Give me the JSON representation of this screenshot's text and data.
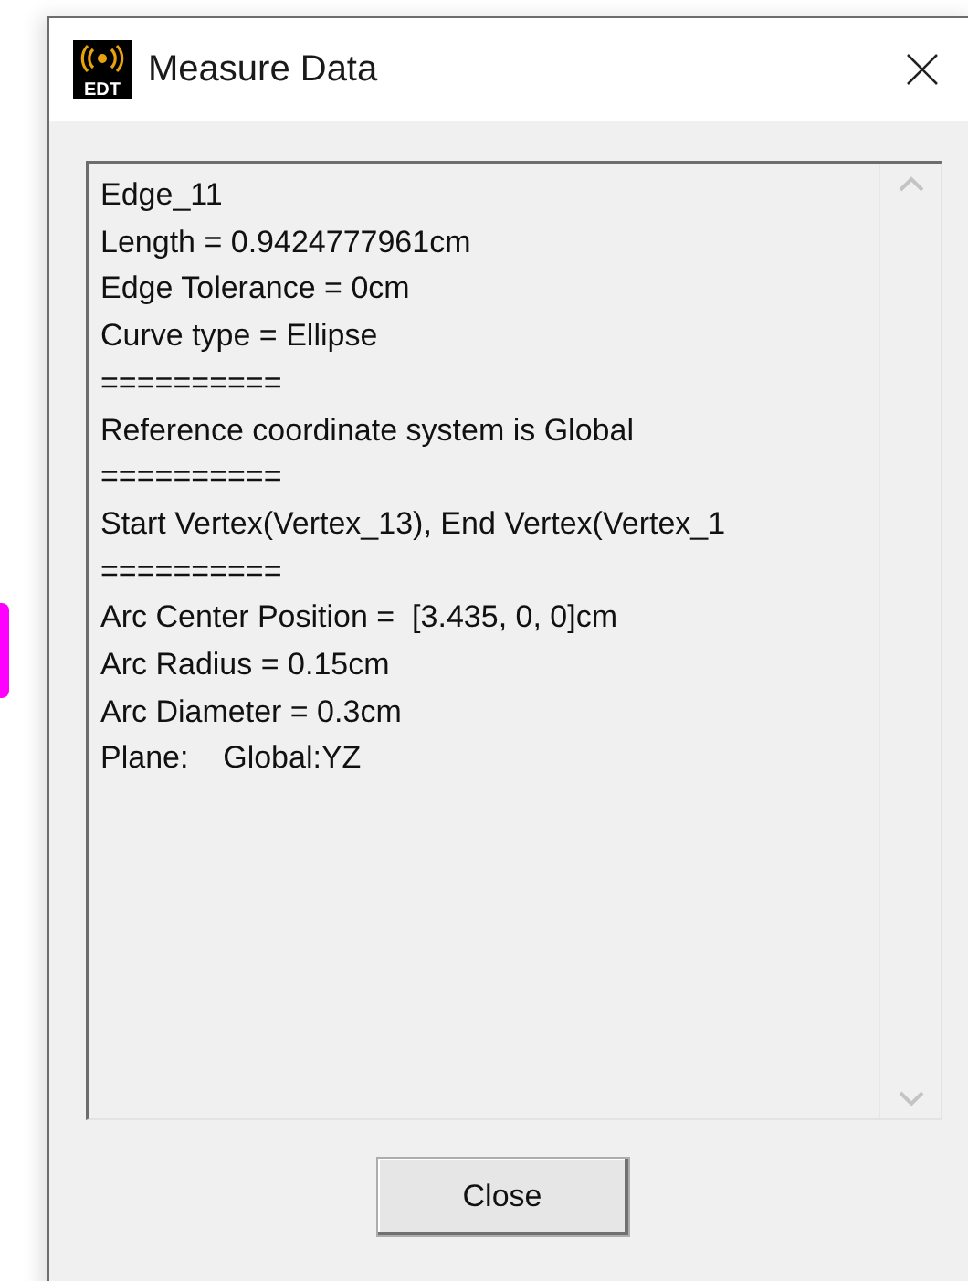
{
  "window": {
    "title": "Measure Data",
    "logo_text": "EDT"
  },
  "lines": [
    "Edge_11",
    "Length = 0.9424777961cm",
    "Edge Tolerance = 0cm",
    "Curve type = Ellipse",
    "==========",
    "Reference coordinate system is Global",
    "==========",
    "Start Vertex(Vertex_13), End Vertex(Vertex_1",
    "==========",
    "Arc Center Position =  [3.435, 0, 0]cm",
    "Arc Radius = 0.15cm",
    "Arc Diameter = 0.3cm",
    "Plane:    Global:YZ"
  ],
  "buttons": [
    "Close"
  ]
}
